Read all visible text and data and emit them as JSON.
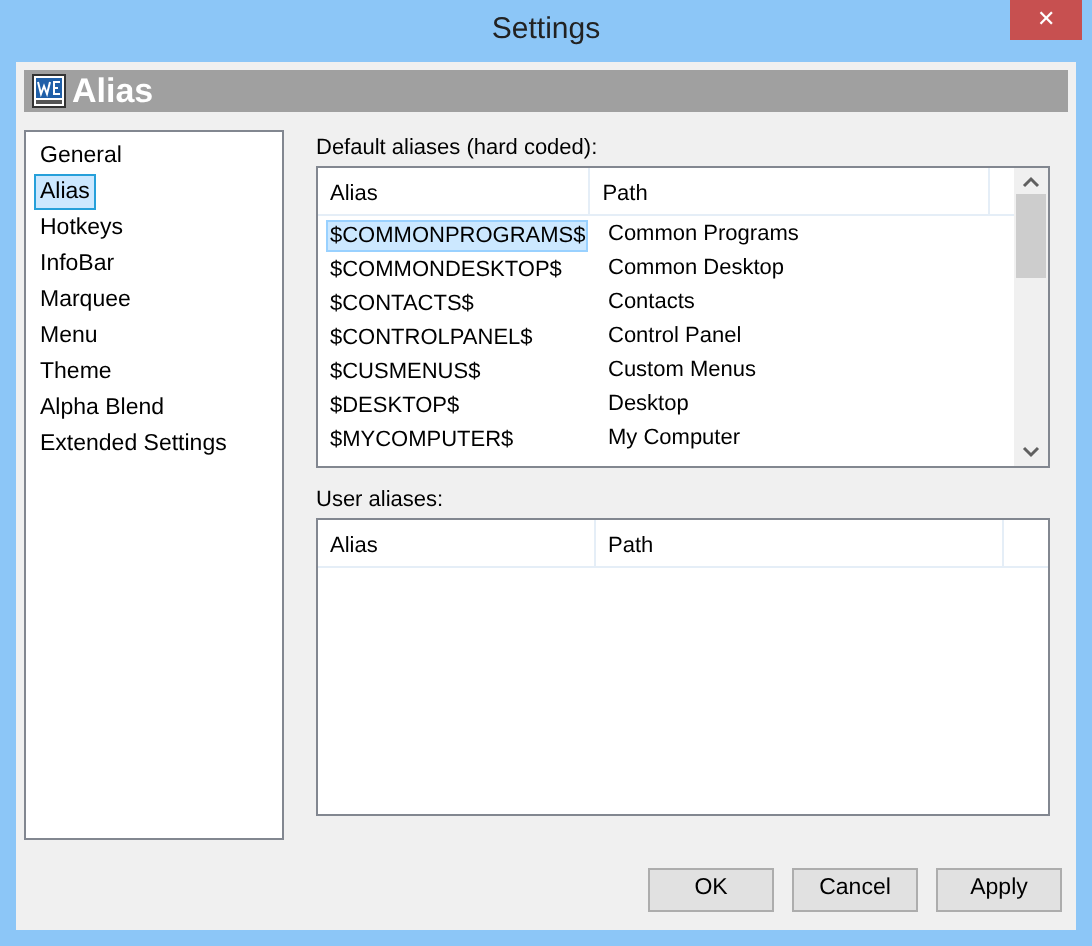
{
  "window": {
    "title": "Settings",
    "close": "✕"
  },
  "header": {
    "title": "Alias"
  },
  "sidebar": {
    "items": [
      {
        "label": "General",
        "selected": false
      },
      {
        "label": "Alias",
        "selected": true
      },
      {
        "label": "Hotkeys",
        "selected": false
      },
      {
        "label": "InfoBar",
        "selected": false
      },
      {
        "label": "Marquee",
        "selected": false
      },
      {
        "label": "Menu",
        "selected": false
      },
      {
        "label": "Theme",
        "selected": false
      },
      {
        "label": "Alpha Blend",
        "selected": false
      },
      {
        "label": "Extended Settings",
        "selected": false
      }
    ]
  },
  "default_aliases": {
    "label": "Default aliases (hard coded):",
    "columns": [
      "Alias",
      "Path"
    ],
    "rows": [
      {
        "alias": "$COMMONPROGRAMS$",
        "path": "Common Programs",
        "selected": true
      },
      {
        "alias": "$COMMONDESKTOP$",
        "path": "Common Desktop",
        "selected": false
      },
      {
        "alias": "$CONTACTS$",
        "path": "Contacts",
        "selected": false
      },
      {
        "alias": "$CONTROLPANEL$",
        "path": "Control Panel",
        "selected": false
      },
      {
        "alias": "$CUSMENUS$",
        "path": "Custom Menus",
        "selected": false
      },
      {
        "alias": "$DESKTOP$",
        "path": "Desktop",
        "selected": false
      },
      {
        "alias": "$MYCOMPUTER$",
        "path": "My Computer",
        "selected": false
      }
    ]
  },
  "user_aliases": {
    "label": "User aliases:",
    "columns": [
      "Alias",
      "Path"
    ]
  },
  "buttons": [
    "OK",
    "Cancel",
    "Apply"
  ]
}
